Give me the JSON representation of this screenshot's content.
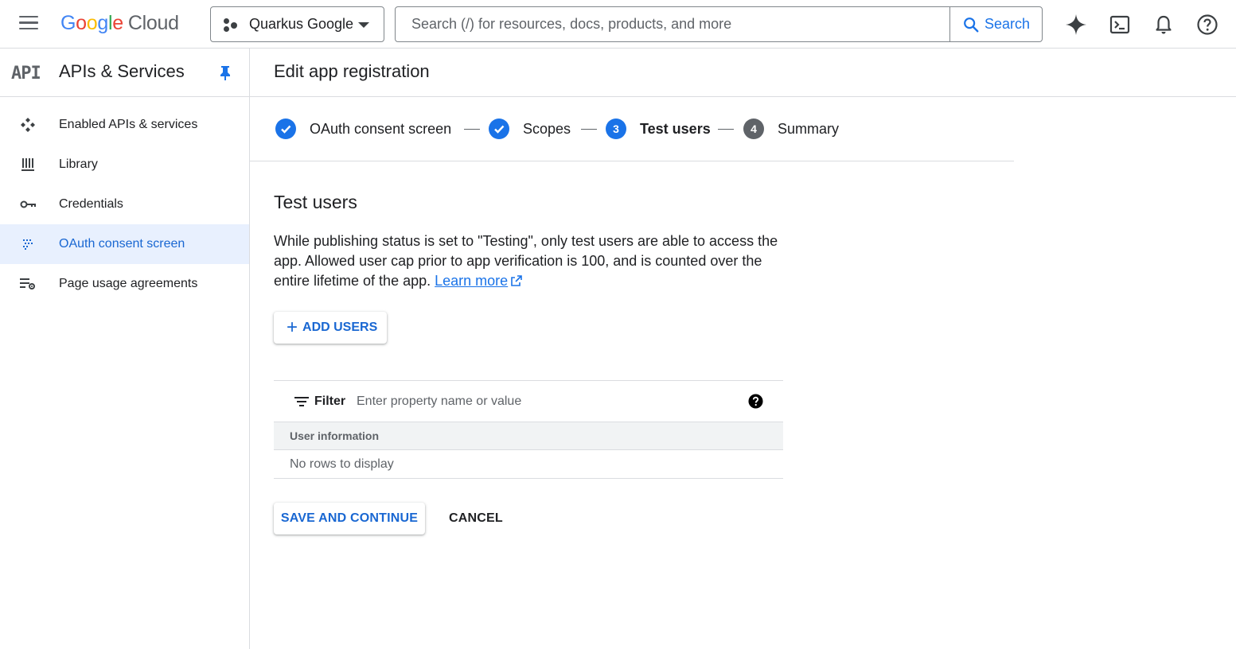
{
  "topbar": {
    "logo": {
      "letters": [
        "G",
        "o",
        "o",
        "g",
        "l",
        "e"
      ],
      "suffix": "Cloud"
    },
    "project": "Quarkus Google",
    "search_placeholder": "Search (/) for resources, docs, products, and more",
    "search_button": "Search",
    "icons": [
      "gemini-icon",
      "cloud-shell-icon",
      "notifications-icon",
      "help-icon"
    ]
  },
  "sidebar": {
    "logo_text": "API",
    "title": "APIs & Services",
    "items": [
      {
        "label": "Enabled APIs & services",
        "icon": "enabled-apis-icon",
        "active": false
      },
      {
        "label": "Library",
        "icon": "library-icon",
        "active": false
      },
      {
        "label": "Credentials",
        "icon": "key-icon",
        "active": false
      },
      {
        "label": "OAuth consent screen",
        "icon": "oauth-icon",
        "active": true
      },
      {
        "label": "Page usage agreements",
        "icon": "settings-list-icon",
        "active": false
      }
    ]
  },
  "page": {
    "title": "Edit app registration"
  },
  "stepper": {
    "steps": [
      {
        "label": "OAuth consent screen",
        "state": "done"
      },
      {
        "label": "Scopes",
        "state": "done"
      },
      {
        "label": "Test users",
        "state": "current",
        "number": "3"
      },
      {
        "label": "Summary",
        "state": "pending",
        "number": "4"
      }
    ]
  },
  "test_users": {
    "title": "Test users",
    "description": "While publishing status is set to \"Testing\", only test users are able to access the app. Allowed user cap prior to app verification is 100, and is counted over the entire lifetime of the app.",
    "learn_more": "Learn more",
    "add_users": "ADD USERS"
  },
  "table": {
    "filter_label": "Filter",
    "filter_placeholder": "Enter property name or value",
    "column": "User information",
    "empty": "No rows to display"
  },
  "actions": {
    "save": "SAVE AND CONTINUE",
    "cancel": "CANCEL"
  },
  "colors": {
    "accent": "#1a73e8",
    "active_bg": "#e8f0fe"
  }
}
